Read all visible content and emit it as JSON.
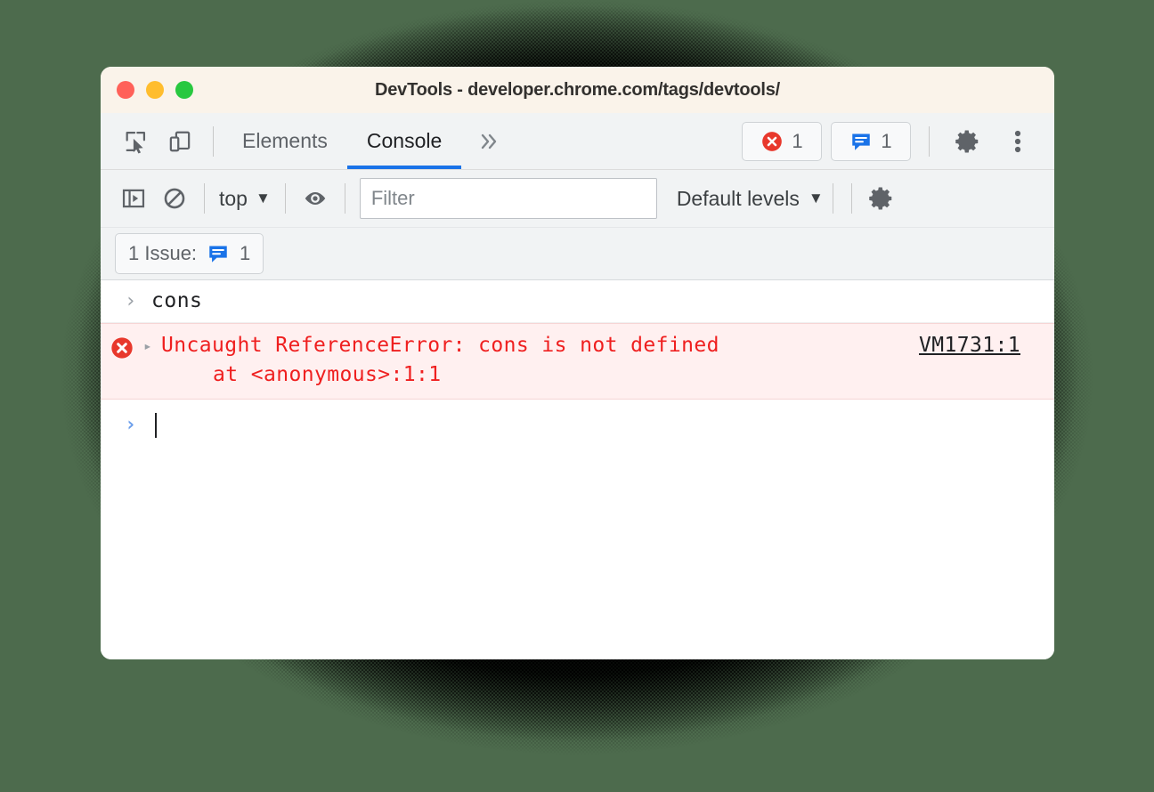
{
  "window": {
    "title": "DevTools - developer.chrome.com/tags/devtools/",
    "traffic_lights": {
      "close": "close-button",
      "minimize": "minimize-button",
      "maximize": "maximize-button"
    }
  },
  "tabbar": {
    "inspect_icon": "inspect-element-icon",
    "device_icon": "device-toolbar-icon",
    "tabs": [
      {
        "label": "Elements",
        "active": false
      },
      {
        "label": "Console",
        "active": true
      }
    ],
    "more_tabs": "»",
    "error_badge": {
      "icon": "error-icon",
      "count": "1"
    },
    "issues_badge": {
      "icon": "issues-icon",
      "count": "1"
    },
    "settings_icon": "gear-icon",
    "more_icon": "three-dot-menu-icon"
  },
  "console_toolbar": {
    "sidebar_icon": "console-sidebar-icon",
    "clear_icon": "clear-console-icon",
    "context": {
      "label": "top",
      "caret": "▼"
    },
    "eye_icon": "live-expression-eye-icon",
    "filter": {
      "placeholder": "Filter",
      "value": ""
    },
    "levels": {
      "label": "Default levels",
      "caret": "▼"
    },
    "settings_icon": "console-settings-gear-icon"
  },
  "issues_bar": {
    "label": "1 Issue:",
    "icon": "issues-icon",
    "count": "1"
  },
  "console": {
    "messages": [
      {
        "type": "command",
        "chevron": "›",
        "text": "cons"
      },
      {
        "type": "error",
        "icon": "error-icon",
        "triangle": "▸",
        "text_line1": "Uncaught ReferenceError: cons is not defined",
        "text_line2": "at <anonymous>:1:1",
        "source_link": "VM1731:1"
      },
      {
        "type": "prompt",
        "chevron": "›",
        "text": ""
      }
    ]
  },
  "colors": {
    "accent_blue": "#1a73e8",
    "error_red": "#ef1f1f",
    "error_bg": "#fff0f0",
    "issue_blue": "#1a73e8",
    "titlebar_bg": "#faf3ea",
    "toolbar_bg": "#f1f3f4",
    "desktop_bg": "#4d6b4d"
  }
}
